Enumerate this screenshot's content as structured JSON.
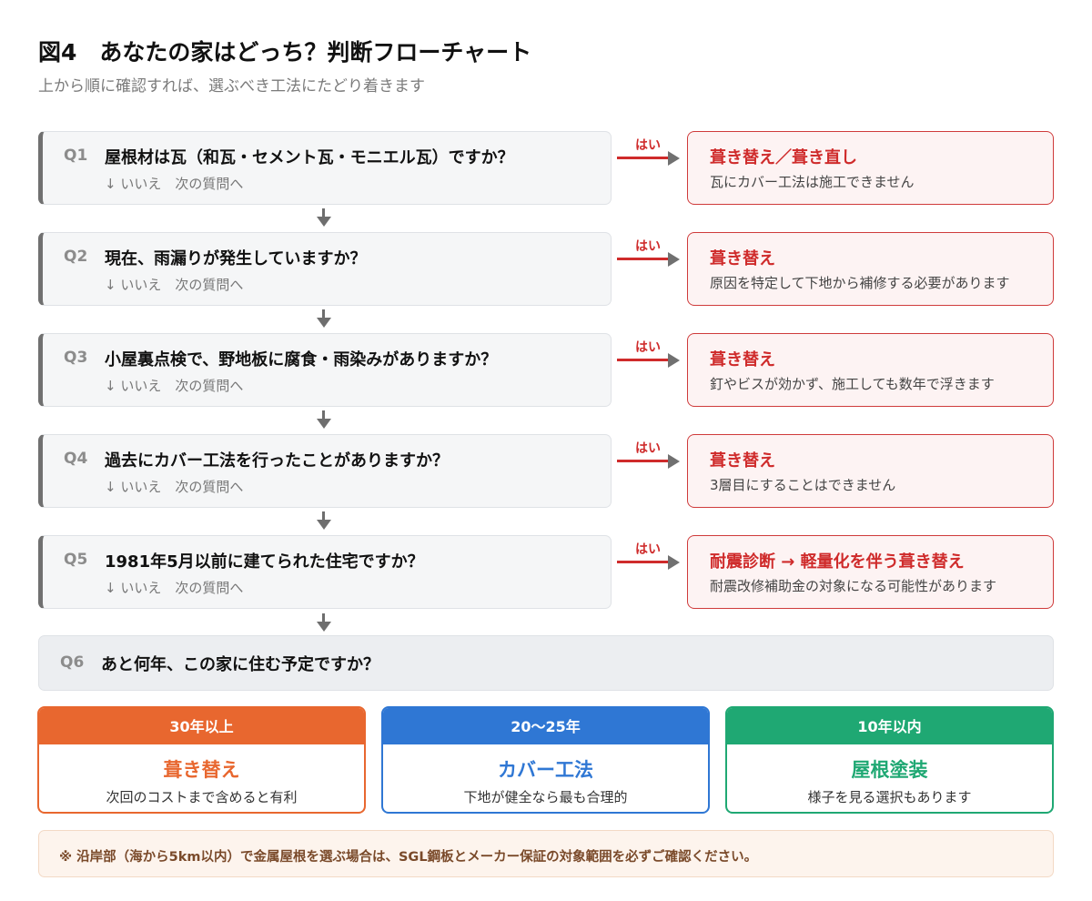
{
  "header": {
    "title": "図4　あなたの家はどっち？判断フローチャート",
    "subtitle": "上から順に確認すれば、選ぶべき工法にたどり着きます"
  },
  "yes_label": "はい",
  "no_label": "↓ いいえ　次の質問へ",
  "questions": [
    {
      "num": "Q1",
      "text": "屋根材は瓦（和瓦・セメント瓦・モニエル瓦）ですか？"
    },
    {
      "num": "Q2",
      "text": "現在、雨漏りが発生していますか？"
    },
    {
      "num": "Q3",
      "text": "小屋裏点検で、野地板に腐食・雨染みがありますか？"
    },
    {
      "num": "Q4",
      "text": "過去にカバー工法を行ったことがありますか？"
    },
    {
      "num": "Q5",
      "text": "1981年5月以前に建てられた住宅ですか？"
    }
  ],
  "answers": [
    {
      "title": "葺き替え／葺き直し",
      "sub": "瓦にカバー工法は施工できません"
    },
    {
      "title": "葺き替え",
      "sub": "原因を特定して下地から補修する必要があります"
    },
    {
      "title": "葺き替え",
      "sub": "釘やビスが効かず、施工しても数年で浮きます"
    },
    {
      "title": "葺き替え",
      "sub": "3層目にすることはできません"
    },
    {
      "title": "耐震診断 → 軽量化を伴う葺き替え",
      "sub": "耐震改修補助金の対象になる可能性があります"
    }
  ],
  "q6": {
    "num": "Q6",
    "text": "あと何年、この家に住む予定ですか？"
  },
  "options": [
    {
      "period": "30年以上",
      "method": "葺き替え",
      "note": "次回のコストまで含めると有利",
      "color": "#e8672f"
    },
    {
      "period": "20〜25年",
      "method": "カバー工法",
      "note": "下地が健全なら最も合理的",
      "color": "#2f77d4"
    },
    {
      "period": "10年以内",
      "method": "屋根塗装",
      "note": "様子を見る選択もあります",
      "color": "#1fa873"
    }
  ],
  "footnote": "※ 沿岸部（海から5km以内）で金属屋根を選ぶ場合は、SGL鋼板とメーカー保証の対象範囲を必ずご確認ください。"
}
